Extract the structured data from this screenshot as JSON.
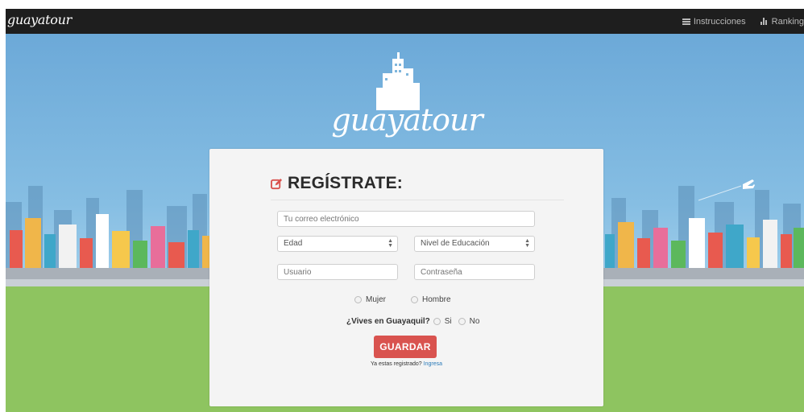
{
  "navbar": {
    "brand": "guayatour",
    "links": [
      {
        "label": "Instrucciones",
        "icon": "list-icon"
      },
      {
        "label": "Ranking",
        "icon": "bar-chart-icon"
      }
    ]
  },
  "hero": {
    "logo_text": "guayatour"
  },
  "form": {
    "title": "REGÍSTRATE:",
    "title_icon": "edit-icon",
    "email_placeholder": "Tu correo electrónico",
    "age_select": "Edad",
    "education_select": "Nivel de Educación",
    "user_placeholder": "Usuario",
    "password_placeholder": "Contraseña",
    "gender_options": [
      "Mujer",
      "Hombre"
    ],
    "live_question": "¿Vives en Guayaquil?",
    "live_options": [
      "Si",
      "No"
    ],
    "submit_label": "GUARDAR",
    "login_prompt": "Ya estas registrado?",
    "login_link": "Ingresa"
  },
  "colors": {
    "navbar": "#1e1e1e",
    "sky": "#7fb6dc",
    "grass": "#8ec460",
    "accent": "#d9534f",
    "link": "#2a7ab8"
  }
}
